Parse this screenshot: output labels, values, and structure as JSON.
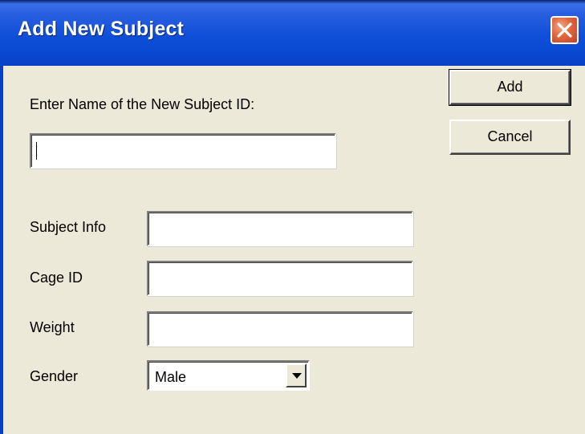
{
  "window": {
    "title": "Add New Subject",
    "close_icon": "close-icon",
    "titlebar_color": "#0a48d2"
  },
  "form": {
    "subject_id_label": "Enter Name of the New Subject ID:",
    "subject_id_value": "",
    "fields": [
      {
        "label": "Subject Info",
        "value": ""
      },
      {
        "label": "Cage ID",
        "value": ""
      },
      {
        "label": "Weight",
        "value": ""
      }
    ],
    "gender": {
      "label": "Gender",
      "selected": "Male",
      "icon": "chevron-down-icon"
    }
  },
  "buttons": {
    "add": "Add",
    "cancel": "Cancel"
  }
}
